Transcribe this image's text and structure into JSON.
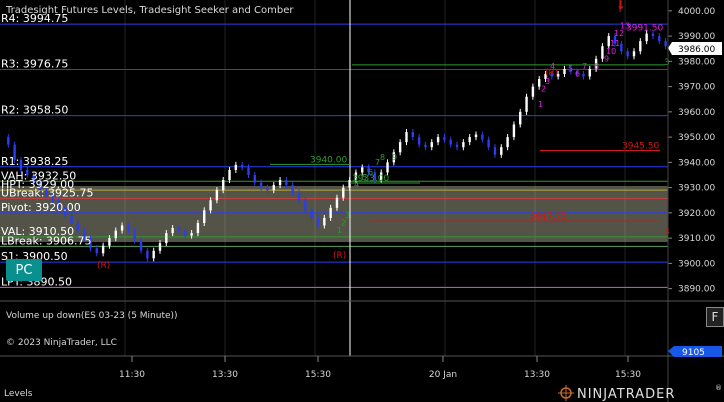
{
  "header": {
    "title": "Tradesight Futures Levels, Tradesight Seeker and Comber",
    "down_arrow": "↓"
  },
  "levels": [
    {
      "label": "R4: 3994.75",
      "value": 3994.75,
      "color": "#2a3df0"
    },
    {
      "label": "R3: 3976.75",
      "value": 3976.75,
      "color": "#2a3df0"
    },
    {
      "label": "R2: 3958.50",
      "value": 3958.5,
      "color": "#2a3df0"
    },
    {
      "label": "R1: 3938.25",
      "value": 3938.25,
      "color": "#2a3df0"
    },
    {
      "label": "VAH: 3932.50",
      "value": 3932.5,
      "color": "#2e9b2e"
    },
    {
      "label": "HPT: 3929.00",
      "value": 3929.0,
      "color": "#b3a63c"
    },
    {
      "label": "UBreak: 3925.75",
      "value": 3925.75,
      "color": "#c84141"
    },
    {
      "label": "Pivot: 3920.00",
      "value": 3920.0,
      "color": "#2a3df0"
    },
    {
      "label": "VAL: 3910.50",
      "value": 3910.5,
      "color": "#2e9b2e"
    },
    {
      "label": "LBreak: 3906.75",
      "value": 3906.75,
      "color": "#5aa05a"
    },
    {
      "label": "S1: 3900.50",
      "value": 3900.5,
      "color": "#2a3df0"
    },
    {
      "label": "LPT: 3890.50",
      "value": 3890.5,
      "color": "#c266c2"
    }
  ],
  "hidden_label_fragments": {
    "pivot_extra": "50",
    "r1_extra": "50"
  },
  "annotations": [
    {
      "text": "3940.00",
      "x_time": "15:00",
      "y": 3940.0,
      "color": "#2e9b2e"
    },
    {
      "text": "3933.00",
      "x_time": "16:30",
      "y": 3932.6,
      "color": "#2e9b2e"
    },
    {
      "text": "3945.50",
      "x_time": "02:00 20 Jan",
      "y": 3945.5,
      "color": "#d01818"
    },
    {
      "text": "3917.75",
      "x_time": "16:50",
      "y": 3917.5,
      "color": "#d01818"
    },
    {
      "text": "3991.50",
      "x_time": "03:15 20 Jan",
      "y": 3992.3,
      "color": "#e020e0"
    },
    {
      "text": "3",
      "x_time": "end",
      "y": 3978.5,
      "color": "#2e9b2e"
    },
    {
      "text": "3",
      "x_time": "end",
      "y": 3911.5,
      "color": "#d01818"
    }
  ],
  "seeker_labels": [
    {
      "text": "(R)",
      "color": "#d01818"
    },
    {
      "text": "(R)",
      "color": "#d01818"
    },
    {
      "text": "(R)",
      "color": "#d01818"
    }
  ],
  "counts_magenta": [
    "1",
    "2",
    "3",
    "4",
    "5",
    "6",
    "7",
    "8",
    "9",
    "10",
    "11",
    "12",
    "13"
  ],
  "counts_green": [
    "1",
    "2",
    "3",
    "4",
    "5",
    "6",
    "7",
    "8",
    "9"
  ],
  "price_axis": {
    "ticks": [
      "4000.00",
      "3990.00",
      "3980.00",
      "3970.00",
      "3960.00",
      "3950.00",
      "3940.00",
      "3930.00",
      "3920.00",
      "3910.00",
      "3900.00",
      "3890.00"
    ],
    "current_price": "3986.00",
    "min": 3885.5,
    "max": 4003.5
  },
  "time_axis": {
    "ticks": [
      "11:30",
      "13:30",
      "15:30",
      "20 Jan",
      "13:30",
      "15:30"
    ]
  },
  "volume_panel": {
    "title": "Volume up down(ES 03-23 (5 Minute))",
    "value": "9105",
    "f_button": "F"
  },
  "footer": {
    "copyright": "© 2023 NinjaTrader, LLC",
    "tab_label": "Levels",
    "brand": "NINJATRADER",
    "brand_mark": "®"
  },
  "badge": {
    "label": "PC"
  },
  "colors": {
    "background": "#000000",
    "candle_up": "#ffffff",
    "candle_down": "#2a3df0",
    "value_area": "#b8b8a0",
    "grid": "#262626"
  },
  "chart_data": {
    "type": "candlestick",
    "title": "Tradesight Futures Levels, Tradesight Seeker and Comber",
    "xlabel": "",
    "ylabel": "",
    "ylim": [
      3885.5,
      4003.5
    ],
    "x_ticks": [
      "11:30",
      "13:30",
      "15:30",
      "20 Jan",
      "13:30",
      "15:30"
    ],
    "y_ticks": [
      4000,
      3990,
      3980,
      3970,
      3960,
      3950,
      3940,
      3930,
      3920,
      3910,
      3900,
      3890
    ],
    "last_price": 3986.0,
    "volume_last": 9105,
    "close_path": [
      [
        0,
        3950
      ],
      [
        4,
        3947
      ],
      [
        8,
        3941
      ],
      [
        12,
        3937
      ],
      [
        16,
        3935
      ],
      [
        20,
        3932
      ],
      [
        24,
        3929
      ],
      [
        28,
        3927
      ],
      [
        32,
        3925
      ],
      [
        36,
        3922
      ],
      [
        40,
        3919
      ],
      [
        44,
        3916
      ],
      [
        48,
        3913
      ],
      [
        52,
        3910
      ],
      [
        56,
        3906
      ],
      [
        60,
        3904
      ],
      [
        64,
        3907
      ],
      [
        68,
        3910
      ],
      [
        72,
        3913
      ],
      [
        76,
        3915
      ],
      [
        80,
        3913
      ],
      [
        84,
        3909
      ],
      [
        88,
        3905
      ],
      [
        92,
        3902
      ],
      [
        96,
        3905
      ],
      [
        100,
        3908
      ],
      [
        104,
        3912
      ],
      [
        108,
        3914
      ],
      [
        112,
        3913
      ],
      [
        116,
        3911
      ],
      [
        120,
        3912
      ],
      [
        124,
        3916
      ],
      [
        128,
        3921
      ],
      [
        132,
        3925
      ],
      [
        136,
        3929
      ],
      [
        140,
        3933
      ],
      [
        144,
        3937
      ],
      [
        148,
        3939
      ],
      [
        152,
        3938
      ],
      [
        156,
        3935
      ],
      [
        160,
        3932
      ],
      [
        164,
        3930
      ],
      [
        168,
        3929
      ],
      [
        172,
        3931
      ],
      [
        176,
        3933
      ],
      [
        180,
        3931
      ],
      [
        184,
        3928
      ],
      [
        188,
        3925
      ],
      [
        192,
        3921
      ],
      [
        196,
        3918
      ],
      [
        200,
        3915
      ],
      [
        204,
        3918
      ],
      [
        208,
        3922
      ],
      [
        212,
        3926
      ],
      [
        216,
        3930
      ],
      [
        220,
        3933
      ],
      [
        224,
        3936
      ],
      [
        228,
        3938
      ],
      [
        232,
        3936
      ],
      [
        236,
        3933
      ],
      [
        240,
        3936
      ],
      [
        244,
        3940
      ],
      [
        248,
        3944
      ],
      [
        252,
        3948
      ],
      [
        256,
        3952
      ],
      [
        260,
        3950
      ],
      [
        264,
        3947
      ],
      [
        268,
        3946
      ],
      [
        272,
        3948
      ],
      [
        276,
        3950
      ],
      [
        280,
        3949
      ],
      [
        284,
        3947
      ],
      [
        288,
        3946
      ],
      [
        292,
        3948
      ],
      [
        296,
        3950
      ],
      [
        300,
        3951
      ],
      [
        304,
        3949
      ],
      [
        308,
        3946
      ],
      [
        312,
        3943
      ],
      [
        316,
        3946
      ],
      [
        320,
        3950
      ],
      [
        324,
        3955
      ],
      [
        328,
        3960
      ],
      [
        332,
        3966
      ],
      [
        336,
        3970
      ],
      [
        340,
        3973
      ],
      [
        344,
        3975
      ],
      [
        348,
        3974
      ],
      [
        352,
        3975
      ],
      [
        356,
        3977
      ],
      [
        360,
        3976
      ],
      [
        364,
        3975
      ],
      [
        368,
        3974
      ],
      [
        372,
        3977
      ],
      [
        376,
        3981
      ],
      [
        380,
        3986
      ],
      [
        384,
        3990
      ],
      [
        388,
        3987
      ],
      [
        392,
        3984
      ],
      [
        396,
        3982
      ],
      [
        400,
        3984
      ],
      [
        404,
        3988
      ],
      [
        408,
        3991
      ],
      [
        412,
        3990
      ],
      [
        416,
        3988
      ],
      [
        420,
        3986
      ]
    ]
  }
}
